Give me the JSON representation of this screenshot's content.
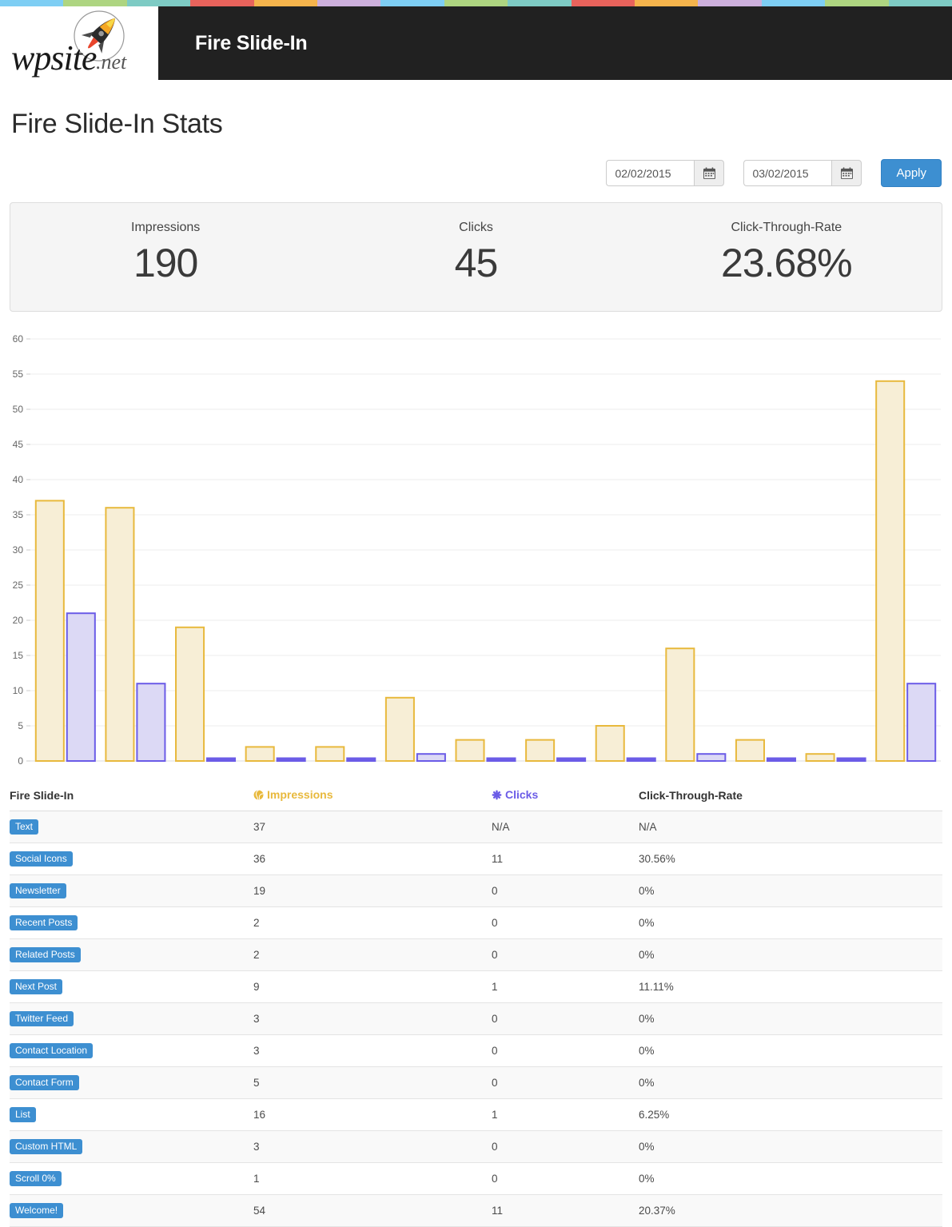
{
  "top_strip": {
    "colors": [
      "#7ecef4",
      "#aed581",
      "#7ecbc4",
      "#e8635c",
      "#f5b44c",
      "#cdb0dc",
      "#7ecef4",
      "#aed581",
      "#7ecbc4",
      "#e8635c",
      "#f5b44c",
      "#cdb0dc",
      "#7ecef4",
      "#aed581",
      "#7ecbc4"
    ]
  },
  "header": {
    "logo_word": "wpsite",
    "logo_tld": ".net",
    "logo_icon": "rocket-icon",
    "title": "Fire Slide-In"
  },
  "page": {
    "title": "Fire Slide-In Stats"
  },
  "filters": {
    "start_date": "02/02/2015",
    "end_date": "03/02/2015",
    "start_placeholder": "mm/dd/yyyy",
    "end_placeholder": "mm/dd/yyyy",
    "calendar_icon": "calendar-icon",
    "apply_label": "Apply"
  },
  "summary": [
    {
      "label": "Impressions",
      "value": "190"
    },
    {
      "label": "Clicks",
      "value": "45"
    },
    {
      "label": "Click-Through-Rate",
      "value": "23.68%"
    }
  ],
  "colors": {
    "impressions_border": "#e8b93d",
    "impressions_fill": "#f7eed6",
    "clicks_border": "#6b5ce7",
    "clicks_fill": "#dcd9f5",
    "badge": "#3d8fd1",
    "accent_button": "#3d8fd1",
    "header_bg": "#212121"
  },
  "chart_data": {
    "type": "bar",
    "title": "",
    "xlabel": "",
    "ylabel": "",
    "ylim": [
      0,
      60
    ],
    "yticks": [
      0,
      5,
      10,
      15,
      20,
      25,
      30,
      35,
      40,
      45,
      50,
      55,
      60
    ],
    "grid": true,
    "legend": [],
    "categories": [
      "Text",
      "Social Icons",
      "Newsletter",
      "Recent Posts",
      "Related Posts",
      "Next Post",
      "Twitter Feed",
      "Contact Location",
      "Contact Form",
      "List",
      "Custom HTML",
      "Scroll 0%",
      "Welcome!"
    ],
    "series": [
      {
        "name": "Impressions",
        "color": "#e8b93d",
        "values": [
          37,
          36,
          19,
          2,
          2,
          9,
          3,
          3,
          5,
          16,
          3,
          1,
          54
        ]
      },
      {
        "name": "Clicks",
        "color": "#6b5ce7",
        "values": [
          21,
          11,
          0,
          0,
          0,
          1,
          0,
          0,
          0,
          1,
          0,
          0,
          11
        ]
      }
    ]
  },
  "table": {
    "headers": {
      "name": "Fire Slide-In",
      "impressions": "Impressions",
      "clicks": "Clicks",
      "ctr": "Click-Through-Rate"
    },
    "header_icons": {
      "impressions": "globe-icon",
      "clicks": "asterisk-icon"
    },
    "rows": [
      {
        "name": "Text",
        "impressions": "37",
        "clicks": "N/A",
        "ctr": "N/A"
      },
      {
        "name": "Social Icons",
        "impressions": "36",
        "clicks": "11",
        "ctr": "30.56%"
      },
      {
        "name": "Newsletter",
        "impressions": "19",
        "clicks": "0",
        "ctr": "0%"
      },
      {
        "name": "Recent Posts",
        "impressions": "2",
        "clicks": "0",
        "ctr": "0%"
      },
      {
        "name": "Related Posts",
        "impressions": "2",
        "clicks": "0",
        "ctr": "0%"
      },
      {
        "name": "Next Post",
        "impressions": "9",
        "clicks": "1",
        "ctr": "11.11%"
      },
      {
        "name": "Twitter Feed",
        "impressions": "3",
        "clicks": "0",
        "ctr": "0%"
      },
      {
        "name": "Contact Location",
        "impressions": "3",
        "clicks": "0",
        "ctr": "0%"
      },
      {
        "name": "Contact Form",
        "impressions": "5",
        "clicks": "0",
        "ctr": "0%"
      },
      {
        "name": "List",
        "impressions": "16",
        "clicks": "1",
        "ctr": "6.25%"
      },
      {
        "name": "Custom HTML",
        "impressions": "3",
        "clicks": "0",
        "ctr": "0%"
      },
      {
        "name": "Scroll 0%",
        "impressions": "1",
        "clicks": "0",
        "ctr": "0%"
      },
      {
        "name": "Welcome!",
        "impressions": "54",
        "clicks": "11",
        "ctr": "20.37%"
      }
    ]
  }
}
